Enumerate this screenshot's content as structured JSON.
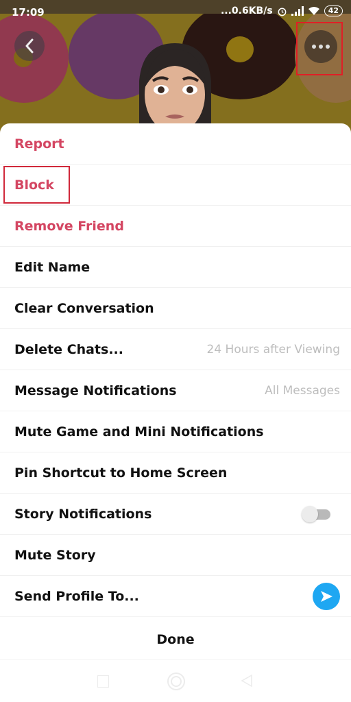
{
  "status_bar": {
    "time": "17:09",
    "network_speed": "...0.6KB/s",
    "battery": "42",
    "icons": [
      "alarm-icon",
      "signal-icon",
      "wifi-icon",
      "battery-icon"
    ]
  },
  "header": {
    "back_icon": "chevron-left-icon",
    "more_icon": "more-horizontal-icon"
  },
  "menu": {
    "items": [
      {
        "label": "Report",
        "style": "danger"
      },
      {
        "label": "Block",
        "style": "danger"
      },
      {
        "label": "Remove Friend",
        "style": "danger"
      },
      {
        "label": "Edit Name"
      },
      {
        "label": "Clear Conversation"
      },
      {
        "label": "Delete Chats...",
        "value": "24 Hours after Viewing"
      },
      {
        "label": "Message Notifications",
        "value": "All Messages"
      },
      {
        "label": "Mute Game and Mini Notifications"
      },
      {
        "label": "Pin Shortcut to Home Screen"
      },
      {
        "label": "Story Notifications",
        "toggle": false
      },
      {
        "label": "Mute Story"
      },
      {
        "label": "Send Profile To...",
        "icon": "send-arrow-icon"
      }
    ],
    "done_label": "Done"
  },
  "colors": {
    "danger": "#d44662",
    "accent": "#1ea7f2",
    "highlight": "#e01f26",
    "secondary_text": "#bdbdbd"
  }
}
